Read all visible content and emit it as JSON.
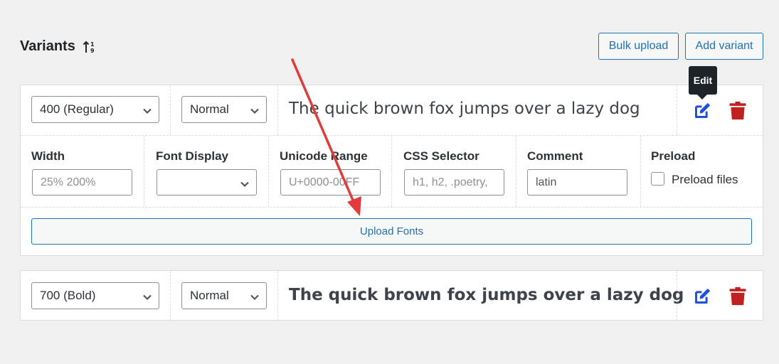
{
  "header": {
    "title": "Variants",
    "sort_icon": "sort-arrows-icon",
    "bulk_upload_label": "Bulk upload",
    "add_variant_label": "Add variant"
  },
  "variants": [
    {
      "weight": "400 (Regular)",
      "style": "Normal",
      "preview_text": "The quick brown fox jumps over a lazy dog",
      "tooltip": "Edit",
      "fields": {
        "width_label": "Width",
        "width_placeholder": "25% 200%",
        "font_display_label": "Font Display",
        "font_display_value": "",
        "unicode_range_label": "Unicode Range",
        "unicode_range_placeholder": "U+0000-00FF",
        "css_selector_label": "CSS Selector",
        "css_selector_placeholder": "h1, h2, .poetry,",
        "comment_label": "Comment",
        "comment_value": "latin",
        "preload_label": "Preload",
        "preload_files_label": "Preload files"
      },
      "upload_fonts_label": "Upload Fonts"
    },
    {
      "weight": "700 (Bold)",
      "style": "Normal",
      "preview_text": "The quick brown fox jumps over a lazy dog"
    }
  ],
  "colors": {
    "accent": "#2271b1",
    "edit_icon": "#1e4fd8",
    "delete_icon": "#c0201f",
    "annotation_arrow": "#e03c3c"
  },
  "icons": {
    "edit": "edit-icon",
    "delete": "trash-icon",
    "dropdown": "chevron-down-icon"
  }
}
